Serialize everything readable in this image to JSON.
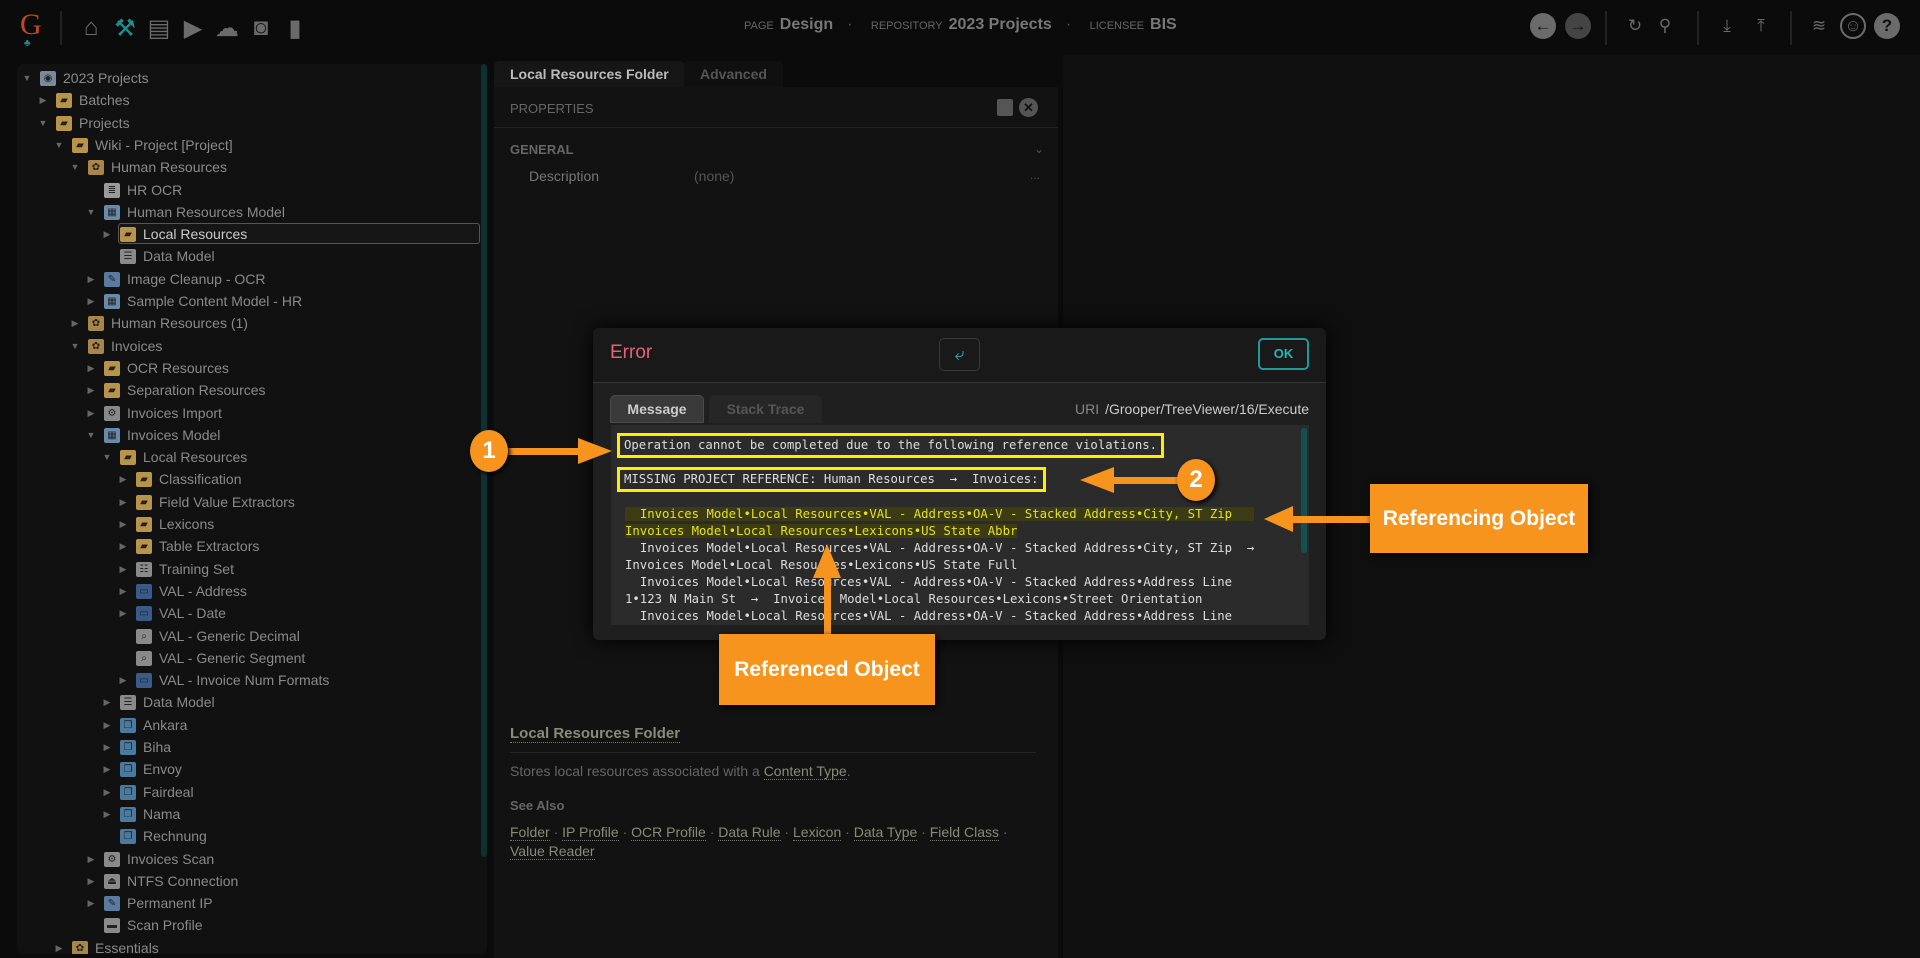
{
  "topbar": {
    "logo": "G",
    "left_icons": [
      "home-icon",
      "tools-icon",
      "archive-icon",
      "media-icon",
      "cloud-upload-icon",
      "briefcase-clock-icon",
      "bar-chart-icon"
    ],
    "page_label": "PAGE",
    "page_value": "Design",
    "repo_label": "REPOSITORY",
    "repo_value": "2023 Projects",
    "licensee_label": "LICENSEE",
    "licensee_value": "BIS",
    "right_icons": [
      "back-icon",
      "forward-icon",
      "refresh-icon",
      "search-icon",
      "download-icon",
      "upload-icon",
      "database-icon",
      "user-icon",
      "help-icon"
    ]
  },
  "tree": [
    {
      "label": "2023 Projects",
      "level": 0,
      "arrow": "down",
      "icon": "database"
    },
    {
      "label": "Batches",
      "level": 1,
      "arrow": "right",
      "icon": "folder"
    },
    {
      "label": "Projects",
      "level": 1,
      "arrow": "down",
      "icon": "folder"
    },
    {
      "label": "Wiki - Project [Project]",
      "level": 2,
      "arrow": "down",
      "icon": "folder"
    },
    {
      "label": "Human Resources",
      "level": 3,
      "arrow": "down",
      "icon": "package"
    },
    {
      "label": "HR OCR",
      "level": 4,
      "arrow": "none",
      "icon": "ocr"
    },
    {
      "label": "Human Resources Model",
      "level": 4,
      "arrow": "down",
      "icon": "model"
    },
    {
      "label": "Local Resources",
      "level": 5,
      "arrow": "right",
      "icon": "localres",
      "selected": true
    },
    {
      "label": "Data Model",
      "level": 5,
      "arrow": "none",
      "icon": "datamodel"
    },
    {
      "label": "Image Cleanup - OCR",
      "level": 4,
      "arrow": "right",
      "icon": "cleanup"
    },
    {
      "label": "Sample Content Model - HR",
      "level": 4,
      "arrow": "right",
      "icon": "model"
    },
    {
      "label": "Human Resources (1)",
      "level": 3,
      "arrow": "right",
      "icon": "package"
    },
    {
      "label": "Invoices",
      "level": 3,
      "arrow": "down",
      "icon": "package"
    },
    {
      "label": "OCR Resources",
      "level": 4,
      "arrow": "right",
      "icon": "folder"
    },
    {
      "label": "Separation Resources",
      "level": 4,
      "arrow": "right",
      "icon": "folder"
    },
    {
      "label": "Invoices Import",
      "level": 4,
      "arrow": "right",
      "icon": "gear"
    },
    {
      "label": "Invoices Model",
      "level": 4,
      "arrow": "down",
      "icon": "model"
    },
    {
      "label": "Local Resources",
      "level": 5,
      "arrow": "down",
      "icon": "localres"
    },
    {
      "label": "Classification",
      "level": 6,
      "arrow": "right",
      "icon": "folder"
    },
    {
      "label": "Field Value Extractors",
      "level": 6,
      "arrow": "right",
      "icon": "folder"
    },
    {
      "label": "Lexicons",
      "level": 6,
      "arrow": "right",
      "icon": "folder"
    },
    {
      "label": "Table Extractors",
      "level": 6,
      "arrow": "right",
      "icon": "folder"
    },
    {
      "label": "Training Set",
      "level": 6,
      "arrow": "right",
      "icon": "trainingset"
    },
    {
      "label": "VAL - Address",
      "level": 6,
      "arrow": "right",
      "icon": "val"
    },
    {
      "label": "VAL - Date",
      "level": 6,
      "arrow": "right",
      "icon": "val"
    },
    {
      "label": "VAL - Generic Decimal",
      "level": 6,
      "arrow": "none",
      "icon": "valsearch"
    },
    {
      "label": "VAL - Generic Segment",
      "level": 6,
      "arrow": "none",
      "icon": "valsearch"
    },
    {
      "label": "VAL - Invoice Num Formats",
      "level": 6,
      "arrow": "right",
      "icon": "val"
    },
    {
      "label": "Data Model",
      "level": 5,
      "arrow": "right",
      "icon": "datamodel"
    },
    {
      "label": "Ankara",
      "level": 5,
      "arrow": "right",
      "icon": "doctype"
    },
    {
      "label": "Biha",
      "level": 5,
      "arrow": "right",
      "icon": "doctype"
    },
    {
      "label": "Envoy",
      "level": 5,
      "arrow": "right",
      "icon": "doctype"
    },
    {
      "label": "Fairdeal",
      "level": 5,
      "arrow": "right",
      "icon": "doctype"
    },
    {
      "label": "Nama",
      "level": 5,
      "arrow": "right",
      "icon": "doctype"
    },
    {
      "label": "Rechnung",
      "level": 5,
      "arrow": "none",
      "icon": "doctype"
    },
    {
      "label": "Invoices Scan",
      "level": 4,
      "arrow": "right",
      "icon": "gear"
    },
    {
      "label": "NTFS Connection",
      "level": 4,
      "arrow": "right",
      "icon": "ntfs"
    },
    {
      "label": "Permanent IP",
      "level": 4,
      "arrow": "right",
      "icon": "cleanup"
    },
    {
      "label": "Scan Profile",
      "level": 4,
      "arrow": "none",
      "icon": "scanprofile"
    },
    {
      "label": "Essentials",
      "level": 2,
      "arrow": "right",
      "icon": "package"
    }
  ],
  "mid": {
    "tabs": [
      "Local Resources Folder",
      "Advanced"
    ],
    "properties_label": "PROPERTIES",
    "section": "GENERAL",
    "property": {
      "name": "Description",
      "value": "(none)",
      "more": "..."
    },
    "help": {
      "title": "Local Resources Folder",
      "desc_prefix": "Stores local resources associated with a ",
      "desc_link": "Content Type",
      "desc_suffix": ".",
      "see_also_label": "See Also",
      "see_also": [
        "Folder",
        "IP Profile",
        "OCR Profile",
        "Data Rule",
        "Lexicon",
        "Data Type",
        "Field Class",
        "Value Reader"
      ]
    }
  },
  "dialog": {
    "title": "Error",
    "ok": "OK",
    "tabs": [
      "Message",
      "Stack Trace"
    ],
    "uri_label": "URI",
    "uri_value": "/Grooper/TreeViewer/16/Execute",
    "line1": "Operation cannot be completed due to the following reference violations.",
    "line2": "MISSING PROJECT REFERENCE: Human Resources  →  Invoices:",
    "entries": [
      "  Invoices Model•Local Resources•VAL - Address•OA-V - Stacked Address•City, ST Zip   Invoices Model•Local Resources•Lexicons•US State Abbr",
      "  Invoices Model•Local Resources•VAL - Address•OA-V - Stacked Address•City, ST Zip  →  Invoices Model•Local Resources•Lexicons•US State Full",
      "  Invoices Model•Local Resources•VAL - Address•OA-V - Stacked Address•Address Line 1•123 N Main St  →  Invoices Model•Local Resources•Lexicons•Street Orientation",
      "  Invoices Model•Local Resources•VAL - Address•OA-V - Stacked Address•Address Line"
    ]
  },
  "annotations": {
    "num1": "1",
    "num2": "2",
    "referencing": "Referencing Object",
    "referenced": "Referenced Object",
    "color": "#f7941d",
    "highlight_color": "#ffee00"
  }
}
